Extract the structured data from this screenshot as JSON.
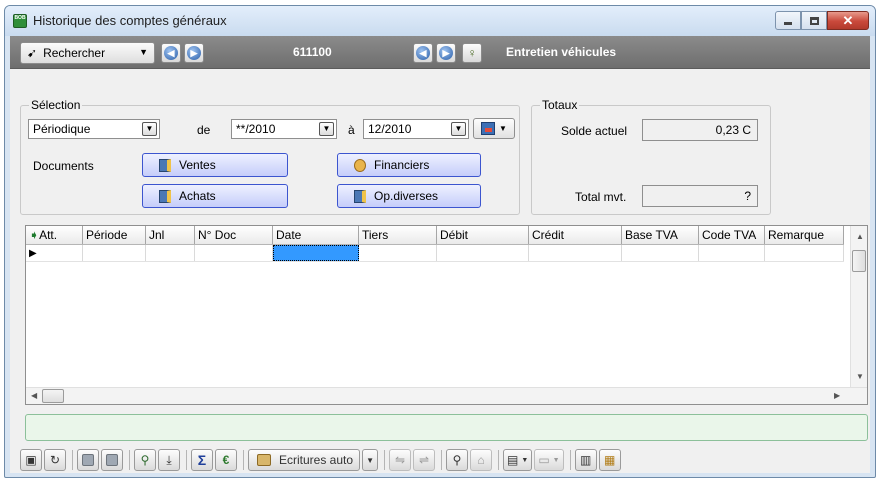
{
  "window": {
    "title": "Historique des comptes généraux",
    "app_icon_text": "BOB"
  },
  "toolbar": {
    "search_label": "Rechercher",
    "account_code": "611100",
    "account_name": "Entretien véhicules"
  },
  "selection": {
    "group_title": "Sélection",
    "period_type": "Périodique",
    "from_label": "de",
    "from_value": "**/2010",
    "to_label": "à",
    "to_value": "12/2010",
    "documents_label": "Documents",
    "buttons": [
      "Ventes",
      "Financiers",
      "Achats",
      "Op.diverses"
    ]
  },
  "totals": {
    "group_title": "Totaux",
    "solde_label": "Solde actuel",
    "solde_value": "0,23 C",
    "total_label": "Total mvt.",
    "total_value": "?"
  },
  "grid": {
    "columns": [
      "Att.",
      "Période",
      "Jnl",
      "N° Doc",
      "Date",
      "Tiers",
      "Débit",
      "Crédit",
      "Base TVA",
      "Code TVA",
      "Remarque"
    ]
  },
  "bottom": {
    "ecritures_label": "Ecritures auto"
  },
  "colors": {
    "nav_bg": "#7d7d7d",
    "selected_cell": "#3399ff",
    "doc_button_border": "#3c55cf",
    "status_border": "#8cc09a"
  }
}
